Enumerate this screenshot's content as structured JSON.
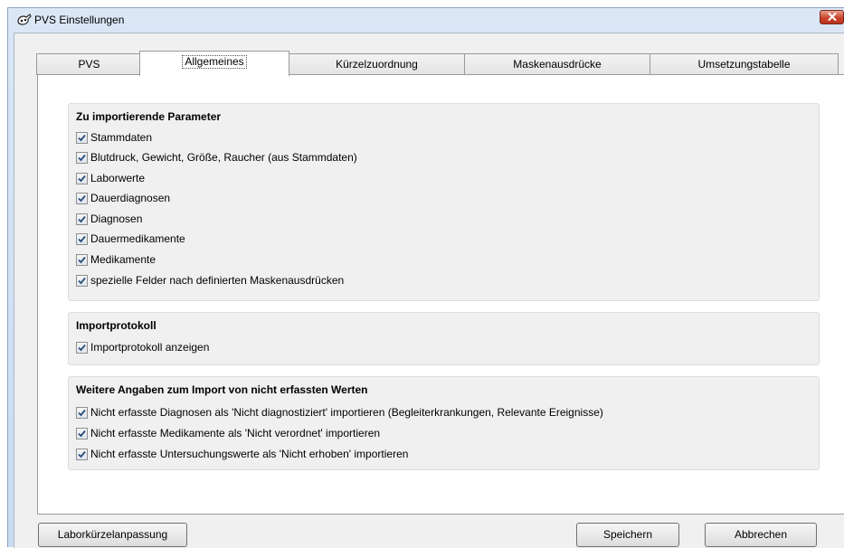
{
  "window": {
    "title": "PVS Einstellungen"
  },
  "tabs": [
    {
      "label": "PVS",
      "active": false
    },
    {
      "label": "Allgemeines",
      "active": true
    },
    {
      "label": "Kürzelzuordnung",
      "active": false
    },
    {
      "label": "Maskenausdrücke",
      "active": false
    },
    {
      "label": "Umsetzungstabelle",
      "active": false
    }
  ],
  "groups": {
    "import_params": {
      "title": "Zu importierende Parameter",
      "items": [
        {
          "label": "Stammdaten",
          "checked": true
        },
        {
          "label": "Blutdruck, Gewicht, Größe, Raucher (aus Stammdaten)",
          "checked": true
        },
        {
          "label": "Laborwerte",
          "checked": true
        },
        {
          "label": "Dauerdiagnosen",
          "checked": true
        },
        {
          "label": "Diagnosen",
          "checked": true
        },
        {
          "label": "Dauermedikamente",
          "checked": true
        },
        {
          "label": "Medikamente",
          "checked": true
        },
        {
          "label": "spezielle Felder nach definierten Maskenausdrücken",
          "checked": true
        }
      ]
    },
    "import_log": {
      "title": "Importprotokoll",
      "items": [
        {
          "label": "Importprotokoll anzeigen",
          "checked": true
        }
      ]
    },
    "further": {
      "title": "Weitere Angaben zum Import von nicht erfassten Werten",
      "items": [
        {
          "label": "Nicht erfasste Diagnosen als 'Nicht diagnostiziert' importieren (Begleiterkrankungen, Relevante Ereignisse)",
          "checked": true
        },
        {
          "label": "Nicht erfasste Medikamente als 'Nicht verordnet' importieren",
          "checked": true
        },
        {
          "label": "Nicht erfasste Untersuchungswerte als 'Nicht erhoben' importieren",
          "checked": true
        }
      ]
    }
  },
  "buttons": {
    "labor": "Laborkürzelanpassung",
    "save": "Speichern",
    "cancel": "Abbrechen"
  },
  "colors": {
    "titlebar": "#c9dcf1",
    "close": "#c9442b",
    "panel": "#ffffff",
    "group_bg": "#f0f0f0",
    "check": "#2a4d7a"
  },
  "icons": {
    "app": "pvs-app-icon",
    "close": "close-icon",
    "checkbox": "checkmark-icon"
  }
}
